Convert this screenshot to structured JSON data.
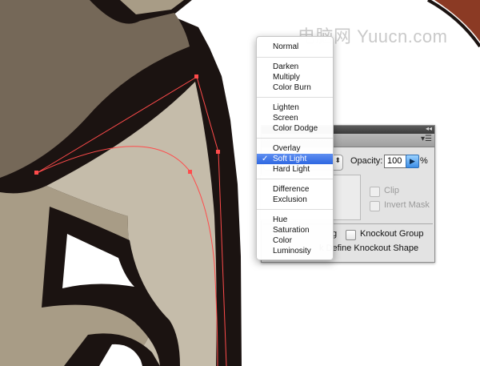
{
  "watermark": {
    "text": "电脑网 Yuucn.com"
  },
  "blend_menu": {
    "items": [
      {
        "label": "Normal",
        "selected": false
      },
      {
        "label": "Darken",
        "selected": false
      },
      {
        "label": "Multiply",
        "selected": false
      },
      {
        "label": "Color Burn",
        "selected": false
      },
      {
        "label": "Lighten",
        "selected": false
      },
      {
        "label": "Screen",
        "selected": false
      },
      {
        "label": "Color Dodge",
        "selected": false
      },
      {
        "label": "Overlay",
        "selected": false
      },
      {
        "label": "Soft Light",
        "selected": true
      },
      {
        "label": "Hard Light",
        "selected": false
      },
      {
        "label": "Difference",
        "selected": false
      },
      {
        "label": "Exclusion",
        "selected": false
      },
      {
        "label": "Hue",
        "selected": false
      },
      {
        "label": "Saturation",
        "selected": false
      },
      {
        "label": "Color",
        "selected": false
      },
      {
        "label": "Luminosity",
        "selected": false
      }
    ],
    "check_glyph": "✓"
  },
  "transparency_panel": {
    "opacity_label": "Opacity:",
    "opacity_value": "100",
    "opacity_unit": "%",
    "clip_label": "Clip",
    "invert_mask_label": "Invert Mask",
    "isolate_fragment": "g",
    "knockout_group_label": "Knockout Group",
    "define_knockout_fragment": "k Define Knockout Shape"
  },
  "colors": {
    "outline": "#1b1311",
    "fill_dark": "#756858",
    "fill_light": "#c5bcaa",
    "fill_mid": "#a89c86",
    "accent_red": "#8b3a24",
    "path_stroke": "#ff4b4b",
    "menu_highlight": "#3a6fe0"
  },
  "icons": {
    "collapse": "collapse-icon",
    "panel_menu": "panel-menu-icon",
    "stepper": "stepper-icon",
    "opacity_arrow": "play-arrow-icon"
  }
}
